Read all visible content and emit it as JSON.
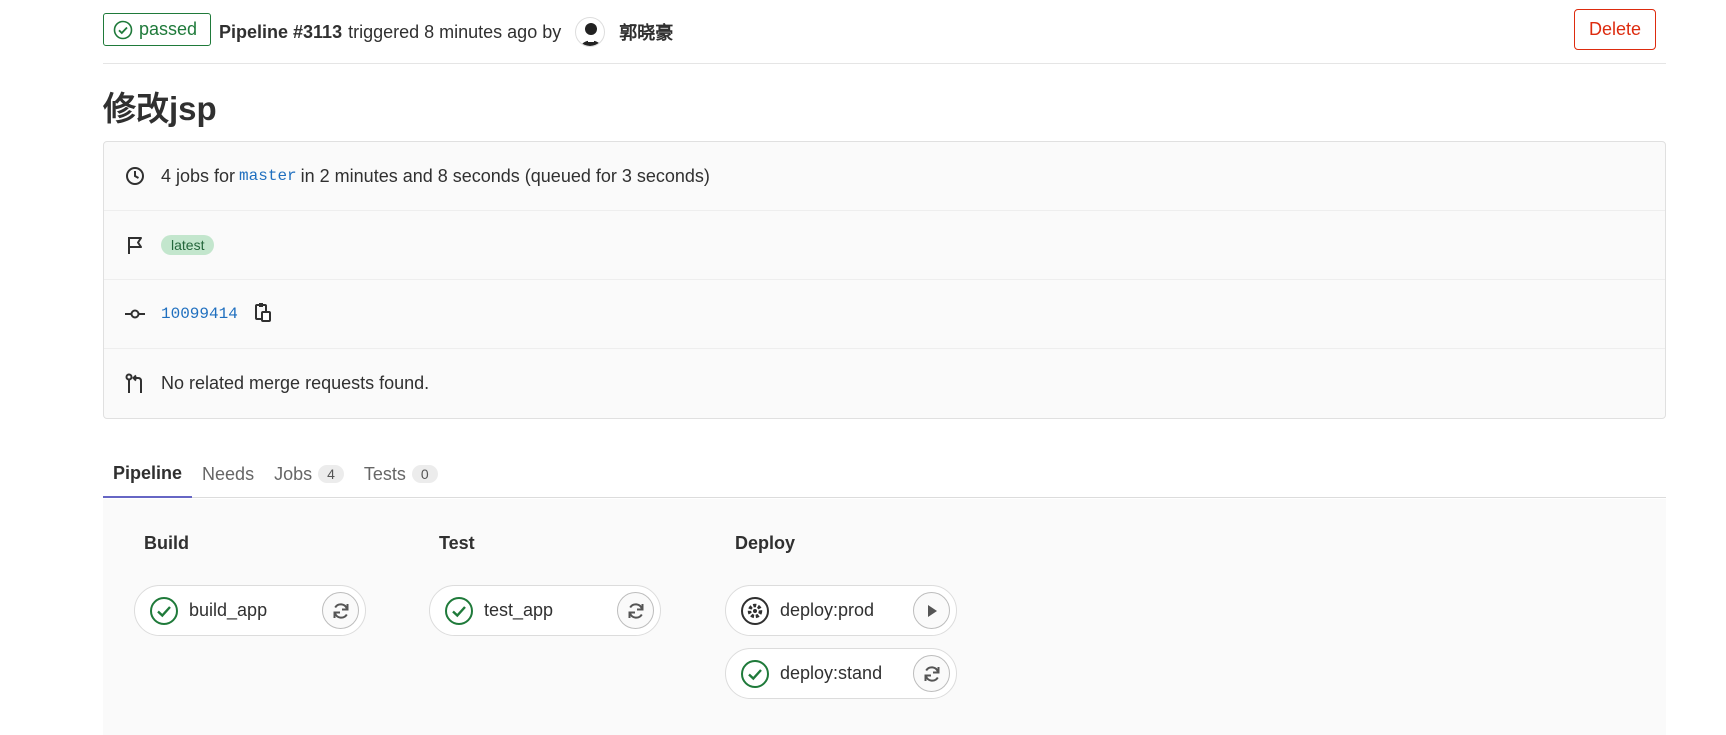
{
  "header": {
    "status": "passed",
    "pipeline_label": "Pipeline #3113",
    "triggered_text": "triggered 8 minutes ago by",
    "author": "郭晓豪",
    "delete_label": "Delete"
  },
  "title": "修改jsp",
  "info": {
    "jobs_prefix": "4 jobs for",
    "branch": "master",
    "jobs_suffix": "in 2 minutes and 8 seconds (queued for 3 seconds)",
    "tag": "latest",
    "commit_sha": "10099414",
    "merge_requests": "No related merge requests found."
  },
  "tabs": [
    {
      "label": "Pipeline"
    },
    {
      "label": "Needs"
    },
    {
      "label": "Jobs",
      "count": "4"
    },
    {
      "label": "Tests",
      "count": "0"
    }
  ],
  "stages": [
    {
      "name": "Build",
      "jobs": [
        {
          "name": "build_app",
          "status": "success",
          "action": "retry"
        }
      ]
    },
    {
      "name": "Test",
      "jobs": [
        {
          "name": "test_app",
          "status": "success",
          "action": "retry"
        }
      ]
    },
    {
      "name": "Deploy",
      "jobs": [
        {
          "name": "deploy:prod",
          "status": "manual",
          "action": "play"
        },
        {
          "name": "deploy:stand",
          "status": "success",
          "action": "retry"
        }
      ]
    }
  ],
  "colors": {
    "success": "#1f7a3a",
    "danger": "#dd2b0e",
    "link": "#1f6fbf",
    "tab_active": "#6666c4"
  }
}
